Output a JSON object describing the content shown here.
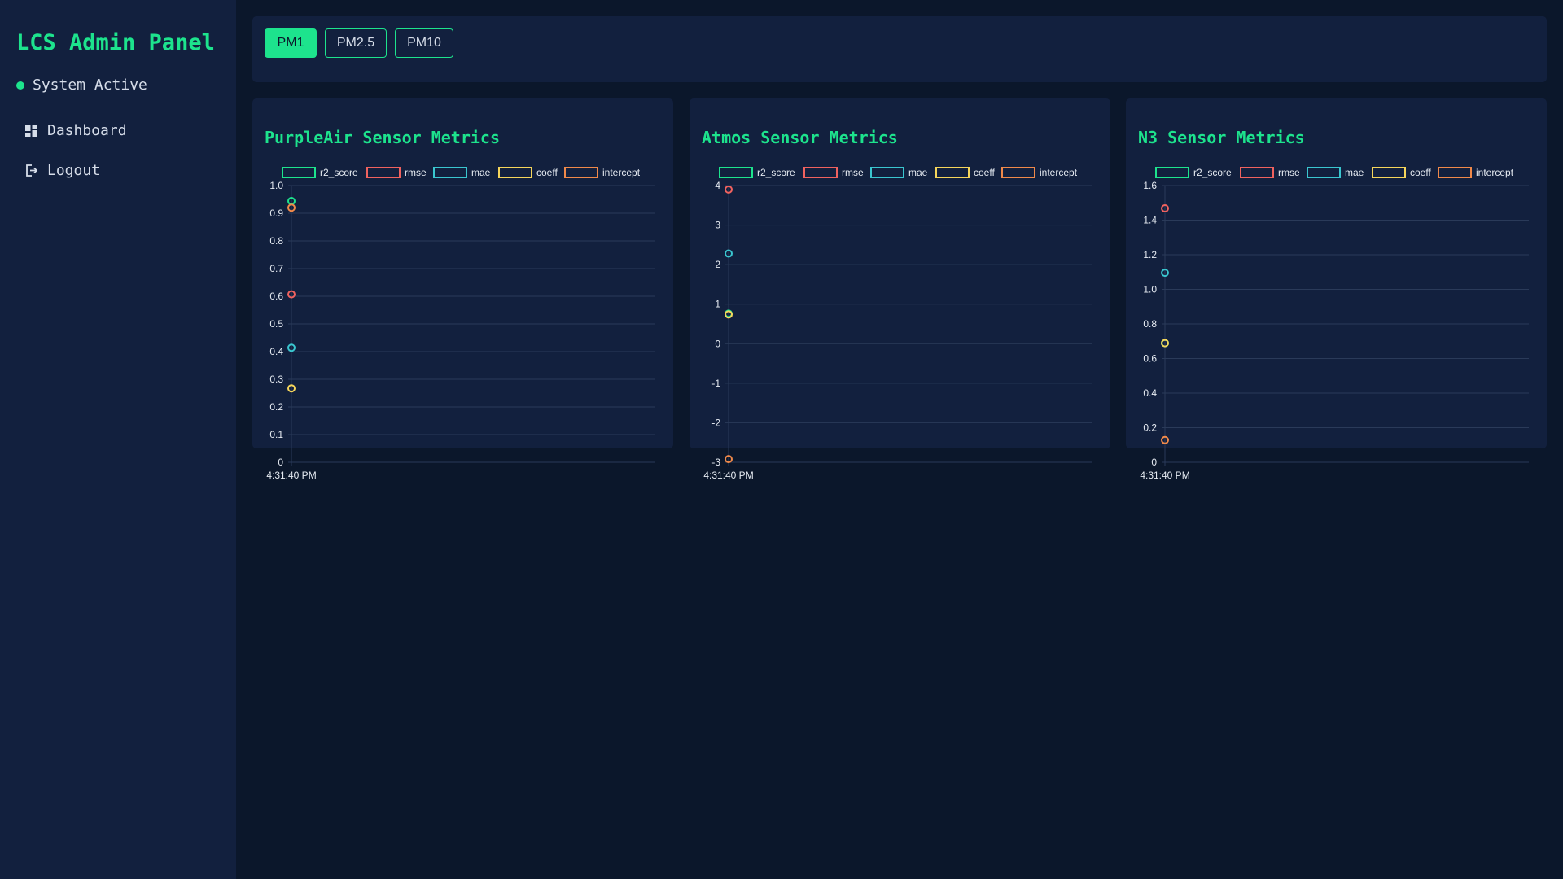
{
  "sidebar": {
    "title": "LCS Admin Panel",
    "status_text": "System Active",
    "status_color": "#1de38d",
    "nav": [
      {
        "label": "Dashboard",
        "icon": "dashboard-icon"
      },
      {
        "label": "Logout",
        "icon": "logout-icon"
      }
    ]
  },
  "tabs": [
    {
      "label": "PM1",
      "active": true
    },
    {
      "label": "PM2.5",
      "active": false
    },
    {
      "label": "PM10",
      "active": false
    }
  ],
  "colors": {
    "accent": "#1de38d",
    "r2_score": "#1de38d",
    "rmse": "#f0625f",
    "mae": "#3ac6cf",
    "coeff": "#f5d55b",
    "intercept": "#f0894a"
  },
  "cards": [
    {
      "title": "PurpleAir Sensor Metrics"
    },
    {
      "title": "Atmos Sensor Metrics"
    },
    {
      "title": "N3 Sensor Metrics"
    }
  ],
  "chart_data": [
    {
      "type": "scatter",
      "title": "PurpleAir Sensor Metrics",
      "x": [
        "4:31:40 PM"
      ],
      "ylim": [
        0,
        1.0
      ],
      "yticks": [
        "0",
        "0.1",
        "0.2",
        "0.3",
        "0.4",
        "0.5",
        "0.6",
        "0.7",
        "0.8",
        "0.9",
        "1.0"
      ],
      "grid": true,
      "legend": "top",
      "series": [
        {
          "name": "r2_score",
          "values": [
            0.944
          ]
        },
        {
          "name": "rmse",
          "values": [
            0.607
          ]
        },
        {
          "name": "mae",
          "values": [
            0.414
          ]
        },
        {
          "name": "coeff",
          "values": [
            0.267
          ]
        },
        {
          "name": "intercept",
          "values": [
            0.92
          ]
        }
      ]
    },
    {
      "type": "scatter",
      "title": "Atmos Sensor Metrics",
      "x": [
        "4:31:40 PM"
      ],
      "ylim": [
        -3,
        4
      ],
      "yticks": [
        "-3",
        "-2",
        "-1",
        "0",
        "1",
        "2",
        "3",
        "4"
      ],
      "grid": true,
      "legend": "top",
      "series": [
        {
          "name": "r2_score",
          "values": [
            0.76
          ]
        },
        {
          "name": "rmse",
          "values": [
            3.9
          ]
        },
        {
          "name": "mae",
          "values": [
            2.28
          ]
        },
        {
          "name": "coeff",
          "values": [
            0.74
          ]
        },
        {
          "name": "intercept",
          "values": [
            -2.92
          ]
        }
      ]
    },
    {
      "type": "scatter",
      "title": "N3 Sensor Metrics",
      "x": [
        "4:31:40 PM"
      ],
      "ylim": [
        0,
        1.6
      ],
      "yticks": [
        "0",
        "0.2",
        "0.4",
        "0.6",
        "0.8",
        "1.0",
        "1.2",
        "1.4",
        "1.6"
      ],
      "grid": true,
      "legend": "top",
      "series": [
        {
          "name": "r2_score",
          "values": [
            0.689
          ]
        },
        {
          "name": "rmse",
          "values": [
            1.468
          ]
        },
        {
          "name": "mae",
          "values": [
            1.096
          ]
        },
        {
          "name": "coeff",
          "values": [
            0.689
          ]
        },
        {
          "name": "intercept",
          "values": [
            0.128
          ]
        }
      ]
    }
  ]
}
